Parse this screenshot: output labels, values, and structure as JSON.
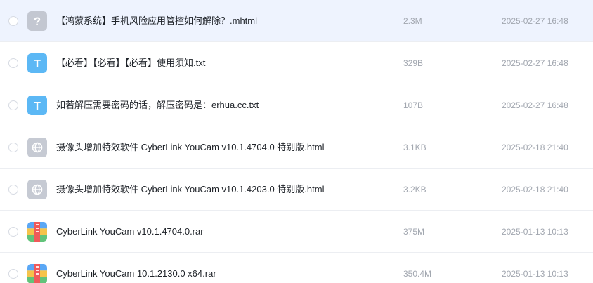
{
  "files": [
    {
      "icon": "unknown-file-icon",
      "name": "【鸿蒙系统】手机风险应用管控如何解除？.mhtml",
      "size": "2.3M",
      "date": "2025-02-27 16:48"
    },
    {
      "icon": "text-file-icon",
      "name": "【必看】【必看】【必看】使用须知.txt",
      "size": "329B",
      "date": "2025-02-27 16:48"
    },
    {
      "icon": "text-file-icon",
      "name": "如若解压需要密码的话，解压密码是：erhua.cc.txt",
      "size": "107B",
      "date": "2025-02-27 16:48"
    },
    {
      "icon": "web-file-icon",
      "name": "摄像头增加特效软件 CyberLink YouCam v10.1.4704.0 特别版.html",
      "size": "3.1KB",
      "date": "2025-02-18 21:40"
    },
    {
      "icon": "web-file-icon",
      "name": "摄像头增加特效软件 CyberLink YouCam v10.1.4203.0 特别版.html",
      "size": "3.2KB",
      "date": "2025-02-18 21:40"
    },
    {
      "icon": "archive-file-icon",
      "name": "CyberLink YouCam v10.1.4704.0.rar",
      "size": "375M",
      "date": "2025-01-13 10:13"
    },
    {
      "icon": "archive-file-icon",
      "name": "CyberLink YouCam 10.1.2130.0 x64.rar",
      "size": "350.4M",
      "date": "2025-01-13 10:13"
    }
  ],
  "icon_glyphs": {
    "text": "T",
    "unknown": "?"
  },
  "colors": {
    "hover_row": "#eef3fe",
    "text_icon": "#5cb8f5",
    "unknown_icon": "#c3c7d1",
    "web_icon": "#c6cad3",
    "meta_text": "#a2a7b0"
  }
}
